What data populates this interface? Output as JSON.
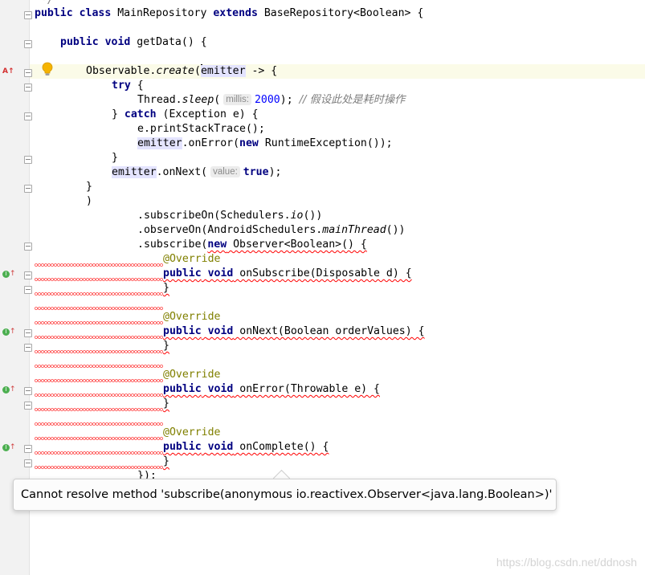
{
  "editor": {
    "lines": {
      "l00": "*/",
      "l01_a": "public",
      "l01_b": "class",
      "l01_c": " MainRepository ",
      "l01_d": "extends",
      "l01_e": " BaseRepository<Boolean> {",
      "l02_a": "public",
      "l02_b": "void",
      "l02_c": " getData() {",
      "l03_a": "Observable.",
      "l03_b": "create",
      "l03_c": "(",
      "l03_d": "emitter",
      "l03_e": " -> {",
      "l04_a": "try",
      "l04_b": " {",
      "l05_a": "Thread.",
      "l05_b": "sleep",
      "l05_c": "(",
      "l05_hint": "millis:",
      "l05_d": "2000",
      "l05_e": "); ",
      "l05_f": "// 假设此处是耗时操作",
      "l06_a": "} ",
      "l06_b": "catch",
      "l06_c": " (Exception e) {",
      "l07": "e.printStackTrace();",
      "l08_a": "emitter",
      "l08_b": ".onError(",
      "l08_c": "new",
      "l08_d": " RuntimeException());",
      "l09": "}",
      "l10_a": "emitter",
      "l10_b": ".onNext(",
      "l10_hint": "value:",
      "l10_c": "true",
      "l10_d": ");",
      "l11": "}",
      "l12": ")",
      "l13_a": ".subscribeOn(Schedulers.",
      "l13_b": "io",
      "l13_c": "())",
      "l14_a": ".observeOn(AndroidSchedulers.",
      "l14_b": "mainThread",
      "l14_c": "())",
      "l15_a": ".subscribe(",
      "l15_b": "new",
      "l15_c": " Observer<Boolean>() {",
      "l16": "@Override",
      "l17_a": "public",
      "l17_b": "void",
      "l17_c": " onSubscribe(Disposable d) {",
      "l18": "}",
      "l20": "@Override",
      "l21_a": "public",
      "l21_b": "void",
      "l21_c": " onNext(Boolean orderValues) {",
      "l22": "}",
      "l24": "@Override",
      "l25_a": "public",
      "l25_b": "void",
      "l25_c": " onError(Throwable e) {",
      "l26": "}",
      "l28": "@Override",
      "l29_a": "public",
      "l29_b": "void",
      "l29_c": " onComplete() {",
      "l30": "}",
      "l31": "});"
    },
    "gutter_icons": {
      "warning": "⚠↑",
      "implements": "I"
    }
  },
  "tooltip": {
    "message": "Cannot resolve method 'subscribe(anonymous io.reactivex.Observer<java.lang.Boolean>)'"
  },
  "watermark": "https://blog.csdn.net/ddnosh",
  "colors": {
    "keyword": "#000080",
    "number": "#0000ff",
    "comment": "#808080",
    "annotation": "#808000",
    "error": "#ff0000",
    "gutter": "#f2f2f2",
    "current_line": "#fbfbe8"
  }
}
